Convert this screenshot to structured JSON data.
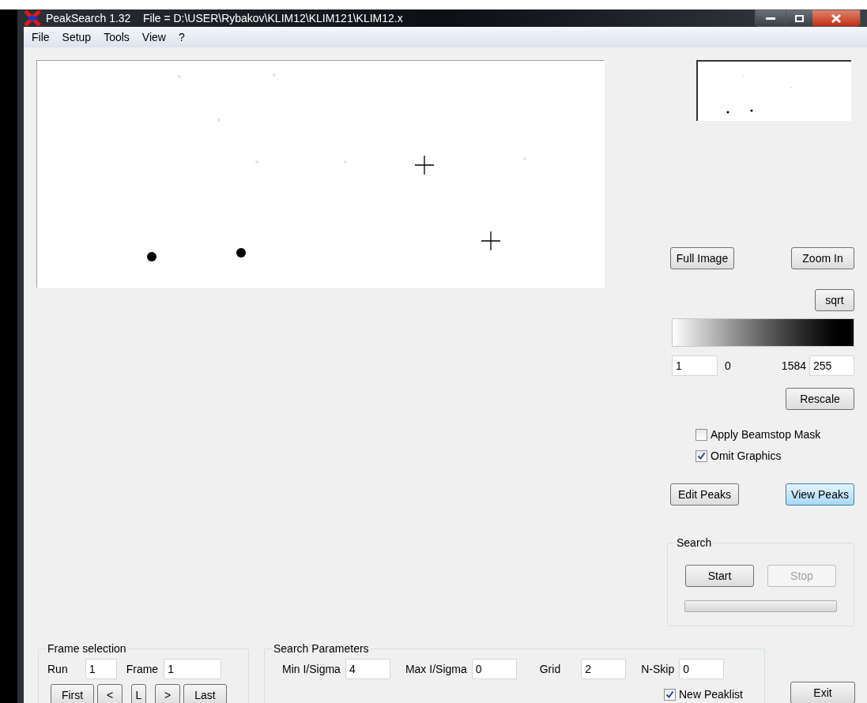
{
  "window": {
    "title": "PeakSearch 1.32    File = D:\\USER\\Rybakov\\KLIM12\\KLIM121\\KLIM12.x"
  },
  "menu": [
    "File",
    "Setup",
    "Tools",
    "View",
    "?"
  ],
  "view_buttons": [
    "Full Image",
    "Zoom In"
  ],
  "scale_button": "sqrt",
  "scale": {
    "min_input": "1",
    "min_label": "0",
    "max_label": "1584",
    "max_input": "255"
  },
  "rescale_button": "Rescale",
  "options": [
    {
      "label": "Apply Beamstop Mask",
      "checked": false
    },
    {
      "label": "Omit Graphics",
      "checked": true
    }
  ],
  "peak_buttons": [
    {
      "label": "Edit Peaks",
      "selected": false
    },
    {
      "label": "View Peaks",
      "selected": true
    }
  ],
  "search": {
    "title": "Search",
    "buttons": [
      {
        "label": "Start",
        "disabled": false
      },
      {
        "label": "Stop",
        "disabled": true
      }
    ],
    "progress": {
      "level": 0
    }
  },
  "frame_selection": {
    "title": "Frame selection",
    "fields": [
      {
        "label": "Run",
        "value": "1"
      },
      {
        "label": "Frame",
        "value": "1"
      }
    ],
    "buttons": [
      "First",
      "<",
      "L",
      ">",
      "Last"
    ]
  },
  "search_parameters": {
    "title": "Search Parameters",
    "fields": [
      {
        "label": "Min I/Sigma",
        "value": "4"
      },
      {
        "label": "Max I/Sigma",
        "value": "0"
      },
      {
        "label": "Grid",
        "value": "2"
      },
      {
        "label": "N-Skip",
        "value": "0"
      }
    ],
    "new_peaklist": {
      "label": "New Peaklist",
      "checked": true
    }
  },
  "exit_button": "Exit"
}
